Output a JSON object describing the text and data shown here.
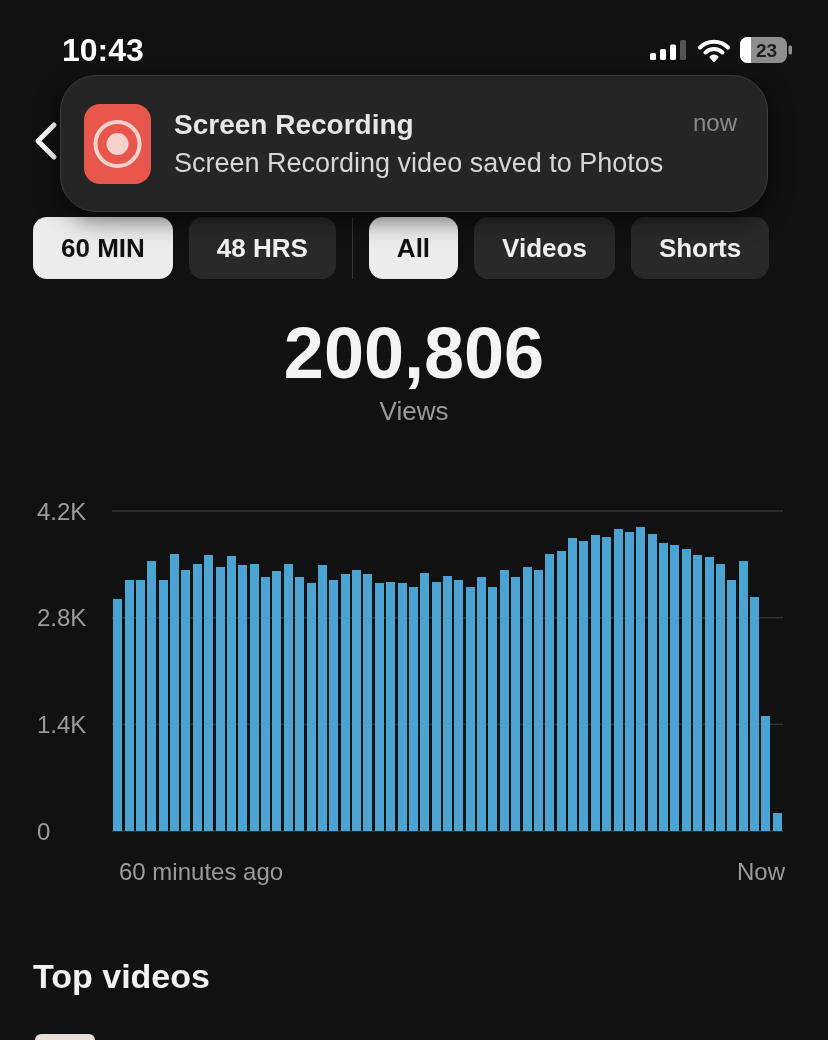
{
  "status_bar": {
    "time": "10:43",
    "battery": "23"
  },
  "notification": {
    "app": "Screen Recording",
    "message": "Screen Recording video saved to Photos",
    "time": "now"
  },
  "time_filters": [
    {
      "label": "60 MIN",
      "selected": true
    },
    {
      "label": "48 HRS",
      "selected": false
    }
  ],
  "content_filters": [
    {
      "label": "All",
      "selected": true
    },
    {
      "label": "Videos",
      "selected": false
    },
    {
      "label": "Shorts",
      "selected": false
    }
  ],
  "summary": {
    "value": "200,806",
    "label": "Views"
  },
  "chart": {
    "chart_data": {
      "type": "bar",
      "values": [
        3040,
        3300,
        3300,
        3540,
        3300,
        3640,
        3430,
        3510,
        3620,
        3460,
        3610,
        3490,
        3510,
        3340,
        3410,
        3510,
        3330,
        3250,
        3490,
        3290,
        3370,
        3430,
        3370,
        3250,
        3270,
        3250,
        3200,
        3390,
        3270,
        3350,
        3300,
        3200,
        3340,
        3200,
        3430,
        3330,
        3460,
        3430,
        3640,
        3670,
        3850,
        3800,
        3880,
        3860,
        3970,
        3920,
        3990,
        3900,
        3780,
        3760,
        3700,
        3620,
        3590,
        3510,
        3300,
        3540,
        3070,
        1510,
        230
      ],
      "ylim": [
        0,
        4200
      ],
      "yticks": [
        {
          "value": 0,
          "label": "0"
        },
        {
          "value": 1400,
          "label": "1.4K"
        },
        {
          "value": 2800,
          "label": "2.8K"
        },
        {
          "value": 4200,
          "label": "4.2K"
        }
      ]
    },
    "start_label": "60 minutes ago",
    "end_label": "Now"
  },
  "top_videos": {
    "title": "Top videos"
  }
}
